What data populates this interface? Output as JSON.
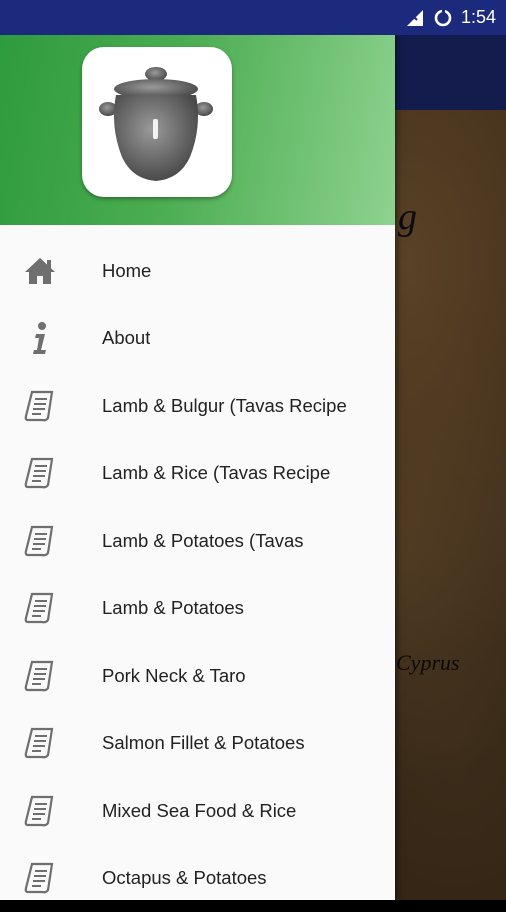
{
  "status_bar": {
    "time": "1:54"
  },
  "app": {
    "partial_title": "g",
    "partial_caption": "Cyprus"
  },
  "drawer": {
    "logo_icon": "clay-pot-icon",
    "menu": [
      {
        "label": "Home",
        "icon": "home-icon"
      },
      {
        "label": "About",
        "icon": "info-icon"
      },
      {
        "label": "Lamb & Bulgur (Tavas Recipe",
        "icon": "recipe-scroll-icon"
      },
      {
        "label": "Lamb & Rice (Tavas Recipe",
        "icon": "recipe-scroll-icon"
      },
      {
        "label": "Lamb & Potatoes (Tavas",
        "icon": "recipe-scroll-icon"
      },
      {
        "label": "Lamb & Potatoes",
        "icon": "recipe-scroll-icon"
      },
      {
        "label": "Pork Neck & Taro",
        "icon": "recipe-scroll-icon"
      },
      {
        "label": "Salmon Fillet & Potatoes",
        "icon": "recipe-scroll-icon"
      },
      {
        "label": "Mixed Sea Food & Rice",
        "icon": "recipe-scroll-icon"
      },
      {
        "label": "Octapus & Potatoes",
        "icon": "recipe-scroll-icon"
      }
    ]
  },
  "colors": {
    "status_bar": "#1b2a7c",
    "header_green": "#4cad52",
    "icon_gray": "#6f6f6f"
  }
}
